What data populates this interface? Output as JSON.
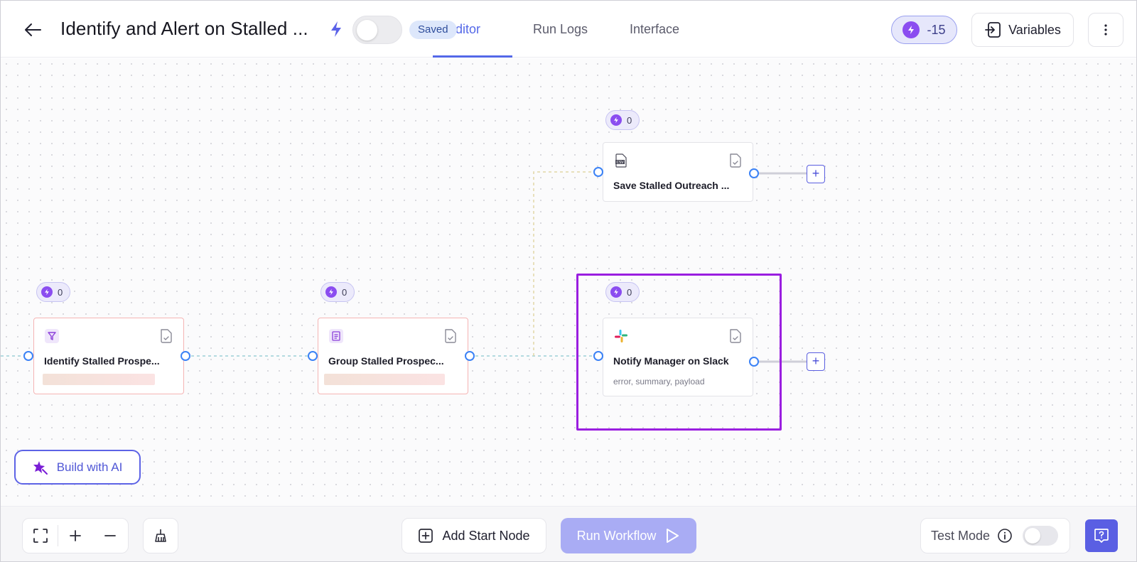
{
  "header": {
    "title": "Identify and Alert on Stalled ...",
    "saved_badge": "Saved",
    "tabs": [
      {
        "label": "Editor",
        "active": true
      },
      {
        "label": "Run Logs",
        "active": false
      },
      {
        "label": "Interface",
        "active": false
      }
    ],
    "credits": "-15",
    "variables_label": "Variables"
  },
  "canvas": {
    "nodes": [
      {
        "id": "identify",
        "title": "Identify Stalled Prospe...",
        "icon": "filter-icon",
        "credits": "0",
        "status": "error"
      },
      {
        "id": "group",
        "title": "Group Stalled Prospec...",
        "icon": "list-icon",
        "credits": "0",
        "status": "error"
      },
      {
        "id": "save",
        "title": "Save Stalled Outreach ...",
        "icon": "csv-file-icon",
        "credits": "0",
        "status": "ok"
      },
      {
        "id": "notify",
        "title": "Notify Manager on Slack",
        "subtitle": "error, summary, payload",
        "icon": "slack-icon",
        "credits": "0",
        "status": "selected"
      }
    ],
    "build_ai_label": "Build with AI"
  },
  "footer": {
    "add_start_label": "Add Start Node",
    "run_label": "Run Workflow",
    "test_mode_label": "Test Mode",
    "test_mode_on": false
  },
  "colors": {
    "accent": "#5468e8",
    "selection": "#9a1ee0",
    "credit_bolt": "#8b4df0",
    "run_disabled": "#a9acf4"
  }
}
